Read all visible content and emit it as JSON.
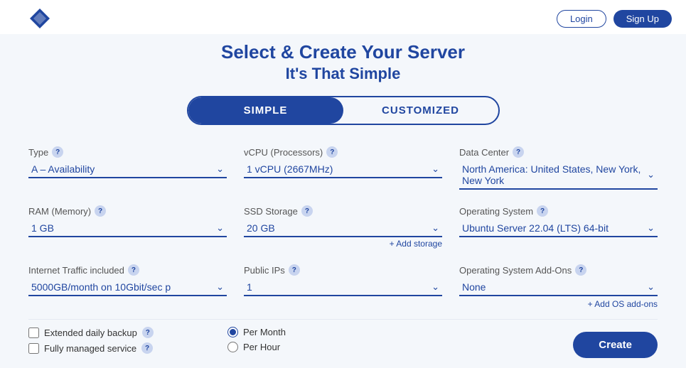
{
  "topbar": {
    "btn_login": "Login",
    "btn_signup": "Sign Up"
  },
  "hero": {
    "line1": "Select & Create Your Server",
    "line2": "It's That Simple"
  },
  "toggle": {
    "simple": "SIMPLE",
    "customized": "CUSTOMIZED"
  },
  "fields": {
    "type": {
      "label": "Type",
      "value": "A – Availability",
      "help": "?"
    },
    "vcpu": {
      "label": "vCPU (Processors)",
      "value": "1 vCPU (2667MHz)",
      "help": "?"
    },
    "datacenter": {
      "label": "Data Center",
      "value": "North America: United States, New York, New York",
      "help": "?"
    },
    "ram": {
      "label": "RAM (Memory)",
      "value": "1 GB",
      "help": "?"
    },
    "ssd": {
      "label": "SSD Storage",
      "value": "20 GB",
      "help": "?"
    },
    "os": {
      "label": "Operating System",
      "value": "Ubuntu Server 22.04 (LTS) 64-bit",
      "help": "?"
    },
    "traffic": {
      "label": "Internet Traffic included",
      "value": "5000GB/month on 10Gbit/sec p",
      "help": "?"
    },
    "public_ips": {
      "label": "Public IPs",
      "value": "1",
      "help": "?"
    },
    "os_addons": {
      "label": "Operating System Add-Ons",
      "value": "None",
      "help": "?"
    }
  },
  "links": {
    "add_storage": "+ Add storage",
    "add_os_addons": "+ Add OS add-ons"
  },
  "bottom": {
    "extended_backup": "Extended daily backup",
    "fully_managed": "Fully managed service",
    "per_month": "Per Month",
    "per_hour": "Per Hour"
  }
}
